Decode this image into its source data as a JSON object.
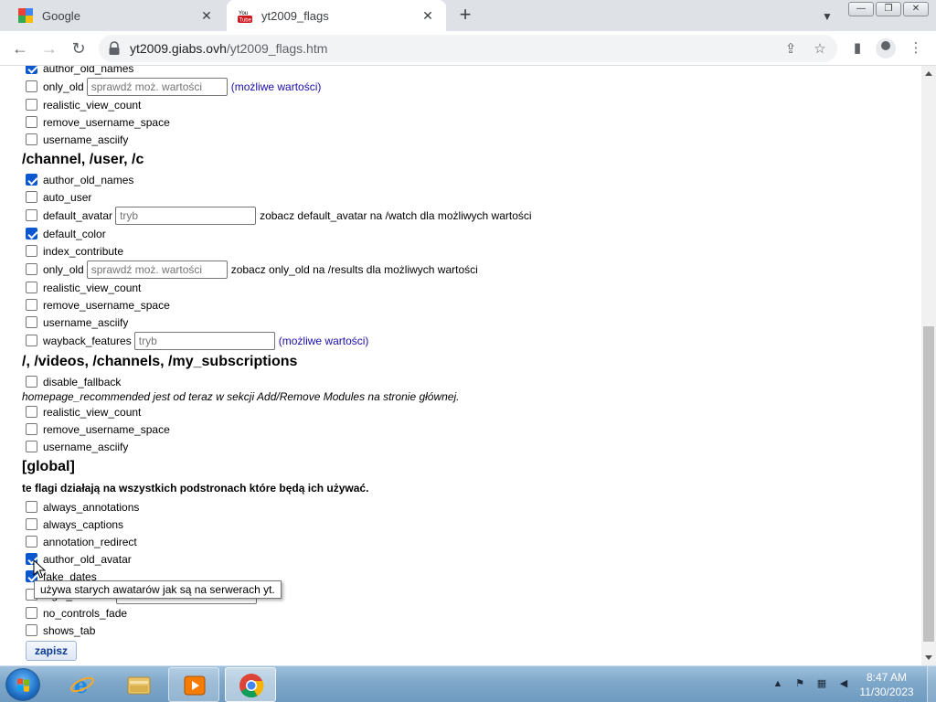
{
  "browser": {
    "tabs": [
      {
        "title": "Google",
        "icon": "google-icon",
        "active": false
      },
      {
        "title": "yt2009_flags",
        "icon": "youtube-icon",
        "active": true
      }
    ],
    "url_host": "yt2009.giabs.ovh",
    "url_path": "/yt2009_flags.htm",
    "window_controls": [
      "minimize",
      "restore",
      "close"
    ]
  },
  "page": {
    "top_group": [
      {
        "flag": "author_old_names",
        "checked": true
      },
      {
        "flag": "only_old",
        "checked": false,
        "placeholder": "sprawdź moż. wartości",
        "link": "(możliwe wartości)"
      },
      {
        "flag": "realistic_view_count",
        "checked": false
      },
      {
        "flag": "remove_username_space",
        "checked": false
      },
      {
        "flag": "username_asciify",
        "checked": false
      }
    ],
    "channel_section": {
      "title": "/channel, /user, /c",
      "flags": [
        {
          "flag": "author_old_names",
          "checked": true
        },
        {
          "flag": "auto_user",
          "checked": false
        },
        {
          "flag": "default_avatar",
          "checked": false,
          "placeholder": "tryb",
          "note": "zobacz default_avatar na /watch dla możliwych wartości"
        },
        {
          "flag": "default_color",
          "checked": true
        },
        {
          "flag": "index_contribute",
          "checked": false
        },
        {
          "flag": "only_old",
          "checked": false,
          "placeholder": "sprawdź moż. wartości",
          "note": "zobacz only_old na /results dla możliwych wartości"
        },
        {
          "flag": "realistic_view_count",
          "checked": false
        },
        {
          "flag": "remove_username_space",
          "checked": false
        },
        {
          "flag": "username_asciify",
          "checked": false
        },
        {
          "flag": "wayback_features",
          "checked": false,
          "placeholder": "tryb",
          "link": "(możliwe wartości)"
        }
      ]
    },
    "home_section": {
      "title": "/, /videos, /channels, /my_subscriptions",
      "flags_before_note": [
        {
          "flag": "disable_fallback",
          "checked": false
        }
      ],
      "note": "homepage_recommended jest od teraz w sekcji Add/Remove Modules na stronie głównej.",
      "flags_after_note": [
        {
          "flag": "realistic_view_count",
          "checked": false
        },
        {
          "flag": "remove_username_space",
          "checked": false
        },
        {
          "flag": "username_asciify",
          "checked": false
        }
      ]
    },
    "global_section": {
      "title": "[global]",
      "description": "te flagi działają na wszystkich podstronach które będą ich używać.",
      "flags": [
        {
          "flag": "always_annotations",
          "checked": false
        },
        {
          "flag": "always_captions",
          "checked": false
        },
        {
          "flag": "annotation_redirect",
          "checked": false
        },
        {
          "flag": "author_old_avatar",
          "checked": true
        },
        {
          "flag": "fake_dates",
          "checked": true
        },
        {
          "flag": "login_simulate",
          "checked": false,
          "placeholder": "nazwa"
        },
        {
          "flag": "no_controls_fade",
          "checked": false
        },
        {
          "flag": "shows_tab",
          "checked": false
        }
      ]
    },
    "save_label": "zapisz",
    "tooltip": "używa starych awatarów jak są na serwerach yt."
  },
  "taskbar": {
    "apps": [
      "internet-explorer-icon",
      "file-explorer-icon",
      "media-player-icon",
      "chrome-icon"
    ],
    "time": "8:47 AM",
    "date": "11/30/2023"
  },
  "colors": {
    "link": "#1a0dab",
    "checkbox_checked": "#0b57d0",
    "taskbar": "#7ea7c9"
  }
}
